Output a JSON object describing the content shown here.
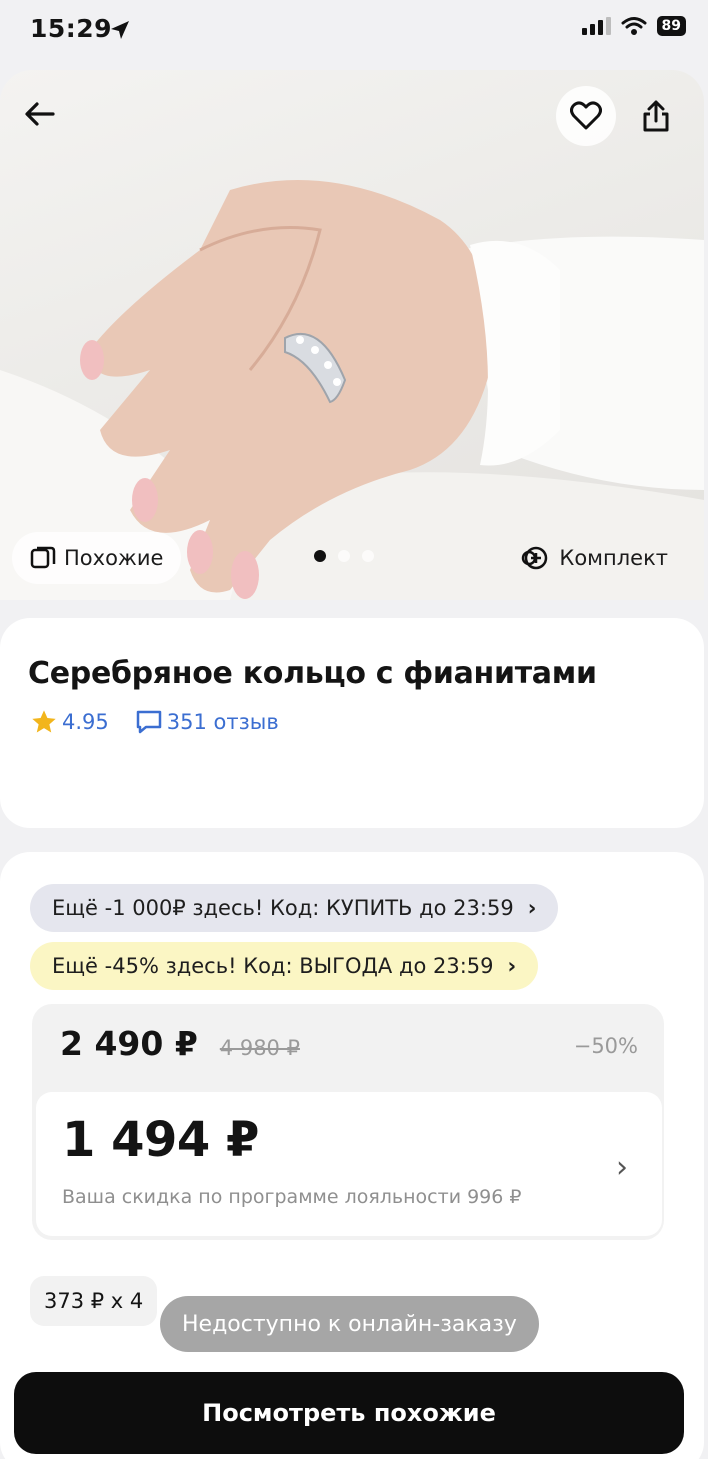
{
  "status_bar": {
    "time": "15:29",
    "battery": "89"
  },
  "hero": {
    "similar_chip_label": "Похожие",
    "set_chip_label": "Комплект",
    "page_count": 3,
    "active_page": 1
  },
  "product": {
    "title": "Серебряное кольцо с фианитами",
    "rating": "4.95",
    "reviews": "351 отзыв"
  },
  "promos": [
    {
      "text": "Ещё -1 000₽ здесь! Код: КУПИТЬ до 23:59",
      "color": "#e5e6ee"
    },
    {
      "text": "Ещё -45% здесь! Код: ВЫГОДА до 23:59",
      "color": "#fbf6c4"
    }
  ],
  "price": {
    "current": "2 490 ₽",
    "old": "4 980 ₽",
    "discount": "−50%",
    "loyalty_price": "1 494 ₽",
    "loyalty_note": "Ваша скидка по программе лояльности 996 ₽"
  },
  "installment": {
    "text": "373 ₽ x 4"
  },
  "toast": {
    "text": "Недоступно к онлайн-заказу"
  },
  "cta": {
    "label": "Посмотреть похожие"
  },
  "colors": {
    "accent_blue": "#3b6ed1",
    "star_yellow": "#f2b51c",
    "cta_black": "#0d0d0d"
  },
  "icons": [
    "location-arrow-icon",
    "signal-icon",
    "wifi-icon",
    "battery-icon",
    "back-arrow-icon",
    "heart-icon",
    "share-icon",
    "similar-icon",
    "add-circle-icon",
    "star-icon",
    "comment-icon",
    "chevron-right-icon"
  ]
}
